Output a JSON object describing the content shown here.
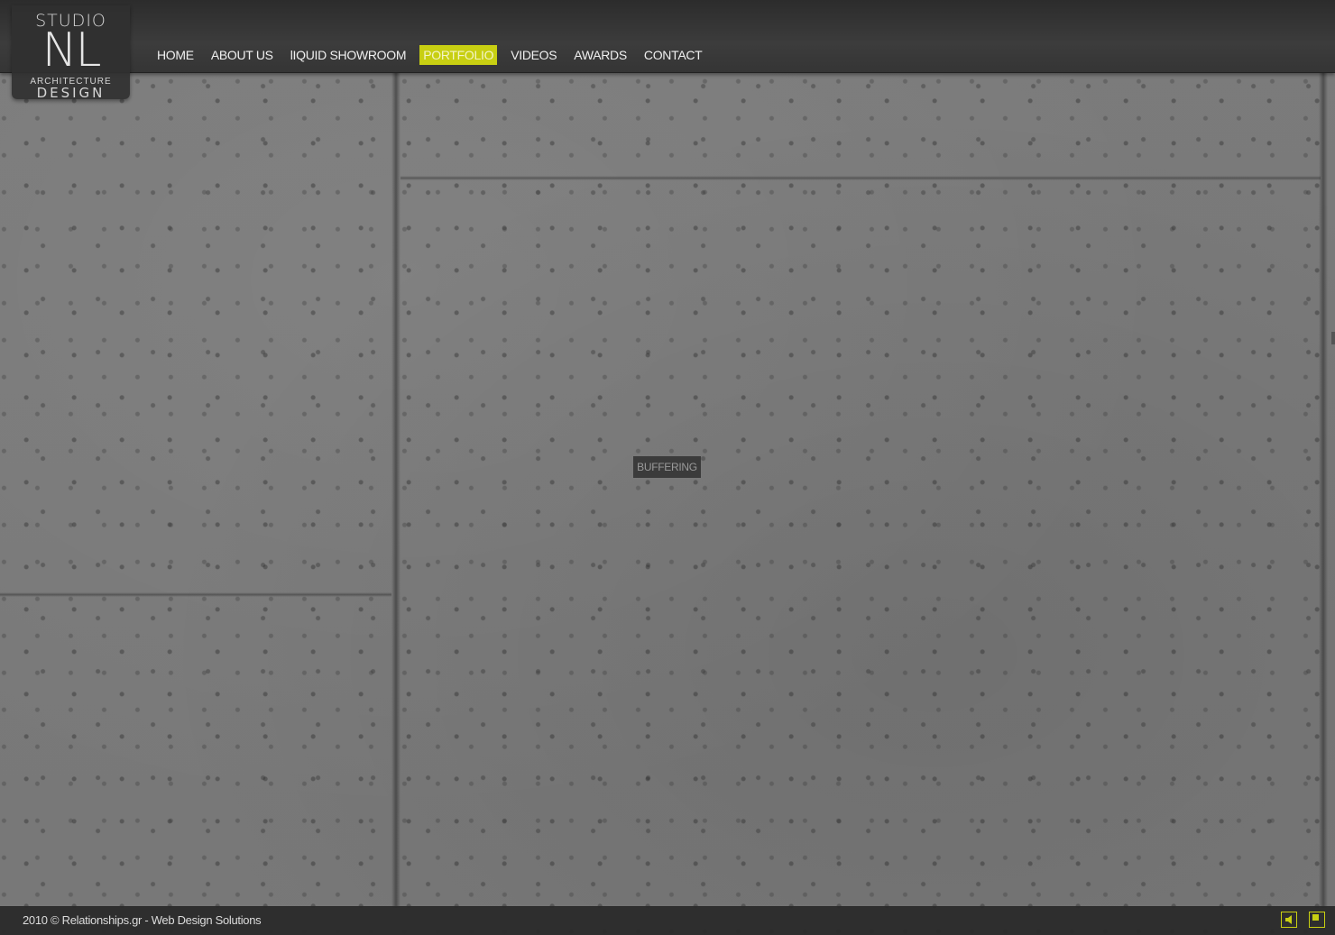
{
  "logo": {
    "line1": "STUDIO",
    "line2": "NL",
    "line3": "ARCHITECTURE",
    "line4": "DESIGN"
  },
  "nav": {
    "items": [
      {
        "label": "HOME",
        "active": false
      },
      {
        "label": "ABOUT US",
        "active": false
      },
      {
        "label": "lIQUID SHOWROOM",
        "active": false
      },
      {
        "label": "PORTFOLIO",
        "active": true
      },
      {
        "label": "VIDEOS",
        "active": false
      },
      {
        "label": "AWARDS",
        "active": false
      },
      {
        "label": "CONTACT",
        "active": false
      }
    ]
  },
  "status": {
    "buffering": "BUFFERING"
  },
  "footer": {
    "copyright": "2010 © Relationships.gr - Web Design Solutions"
  },
  "controls": {
    "sound_icon": "speaker-icon",
    "fullscreen_icon": "fullscreen-icon"
  },
  "colors": {
    "accent": "#c8cf12",
    "bar": "#333333"
  }
}
